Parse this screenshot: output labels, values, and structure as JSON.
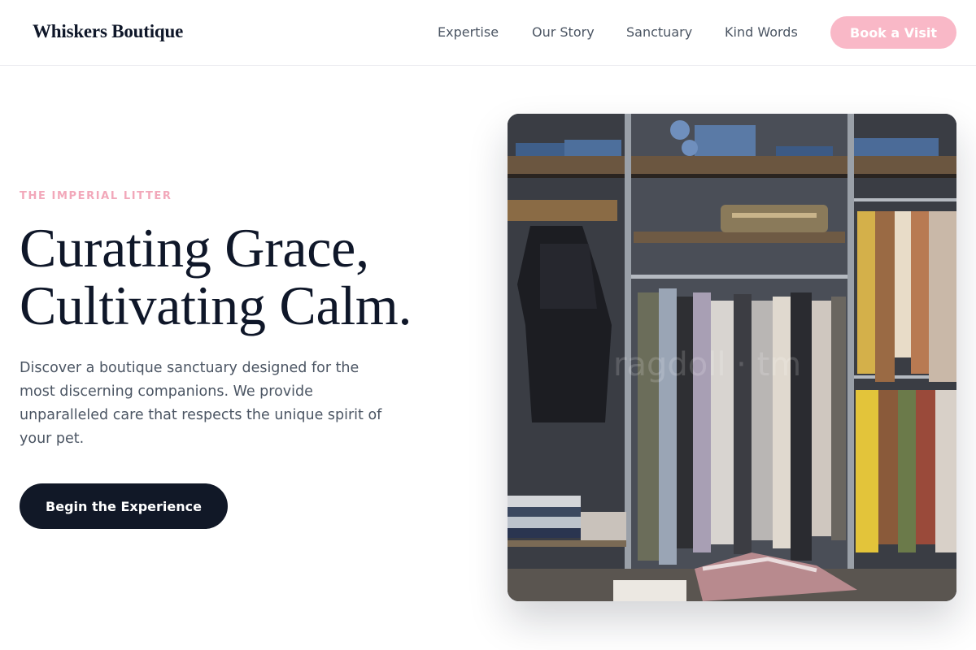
{
  "colors": {
    "accent_pink": "#f9b8c7",
    "eyebrow_pink": "#f2a8ba",
    "navy": "#111827",
    "text_gray": "#4b5563"
  },
  "header": {
    "logo": "Whiskers Boutique",
    "nav": [
      "Expertise",
      "Our Story",
      "Sanctuary",
      "Kind Words"
    ],
    "cta_label": "Book a Visit"
  },
  "hero": {
    "eyebrow": "THE IMPERIAL LITTER",
    "headline_line1": "Curating Grace,",
    "headline_line2": "Cultivating Calm.",
    "description": "Discover a boutique sanctuary designed for the most discerning companions. We provide unparalleled care that respects the unique spirit of your pet.",
    "cta_label": "Begin the Experience",
    "image_subject": "boutique-clothing-rack-photo"
  }
}
